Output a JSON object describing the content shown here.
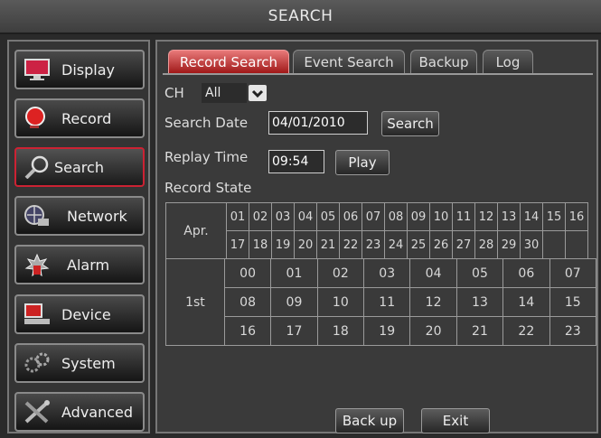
{
  "window": {
    "title": "SEARCH"
  },
  "sidebar": {
    "items": [
      {
        "label": "Display",
        "icon": "monitor-icon"
      },
      {
        "label": "Record",
        "icon": "record-icon"
      },
      {
        "label": "Search",
        "icon": "magnifier-icon",
        "active": true
      },
      {
        "label": "Network",
        "icon": "network-icon"
      },
      {
        "label": "Alarm",
        "icon": "alarm-icon"
      },
      {
        "label": "Device",
        "icon": "device-icon"
      },
      {
        "label": "System",
        "icon": "system-gears-icon"
      },
      {
        "label": "Advanced",
        "icon": "tools-icon"
      }
    ]
  },
  "tabs": [
    {
      "label": "Record Search",
      "active": true
    },
    {
      "label": "Event Search"
    },
    {
      "label": "Backup"
    },
    {
      "label": "Log"
    }
  ],
  "form": {
    "ch_label": "CH",
    "ch_value": "All",
    "search_date_label": "Search Date",
    "search_date_value": "04/01/2010",
    "search_button": "Search",
    "replay_time_label": "Replay Time",
    "replay_time_value": "09:54",
    "play_button": "Play",
    "record_state_label": "Record State"
  },
  "record_state": {
    "month": "Apr.",
    "days_row1": [
      "01",
      "02",
      "03",
      "04",
      "05",
      "06",
      "07",
      "08",
      "09",
      "10",
      "11",
      "12",
      "13",
      "14",
      "15",
      "16"
    ],
    "days_row2": [
      "17",
      "18",
      "19",
      "20",
      "21",
      "22",
      "23",
      "24",
      "25",
      "26",
      "27",
      "28",
      "29",
      "30",
      "",
      ""
    ],
    "day_label": "1st",
    "hours": [
      [
        "00",
        "01",
        "02",
        "03",
        "04",
        "05",
        "06",
        "07"
      ],
      [
        "08",
        "09",
        "10",
        "11",
        "12",
        "13",
        "14",
        "15"
      ],
      [
        "16",
        "17",
        "18",
        "19",
        "20",
        "21",
        "22",
        "23"
      ]
    ]
  },
  "footer": {
    "backup_button": "Back up",
    "exit_button": "Exit"
  },
  "colors": {
    "accent": "#c0282a",
    "panel": "#3a3a3a",
    "border": "#9a9a9a"
  }
}
